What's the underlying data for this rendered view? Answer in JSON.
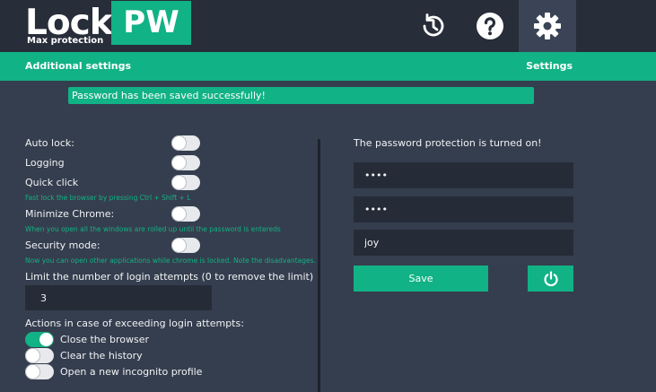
{
  "header": {
    "logo_main": "Lock",
    "logo_sub": "Max protection",
    "logo_badge": "PW",
    "icons": [
      "history-icon",
      "help-icon",
      "gear-icon"
    ]
  },
  "nav": {
    "additional_settings": "Additional settings",
    "settings": "Settings"
  },
  "banner": {
    "message": "Password has been saved successfully!"
  },
  "left": {
    "auto_lock": {
      "label": "Auto lock:",
      "on": false
    },
    "logging": {
      "label": "Logging",
      "on": false
    },
    "quick_click": {
      "label": "Quick click",
      "hint": "Fast lock the browser by pressing Ctrl + Shift + L",
      "on": false
    },
    "minimize_chrome": {
      "label": "Minimize Chrome:",
      "hint": "When you open all the windows are rolled up until the password is entereds",
      "on": false
    },
    "security_mode": {
      "label": "Security mode:",
      "hint": "Now you can open other applications while chrome is locked. Note the disadvantages.",
      "on": false
    },
    "limit_label": "Limit the number of login attempts (0 to remove the limit)",
    "limit_value": "3",
    "actions_label": "Actions in case of exceeding login attempts:",
    "actions": [
      {
        "label": "Close the browser",
        "on": true
      },
      {
        "label": "Clear the history",
        "on": false
      },
      {
        "label": "Open a new incognito profile",
        "on": false
      }
    ]
  },
  "right": {
    "status": "The password protection is turned on!",
    "password": "••••",
    "password_confirm": "••••",
    "hint_value": "joy",
    "save_label": "Save",
    "power_icon": "power-icon"
  },
  "colors": {
    "accent": "#11b285",
    "header_bg": "#272d39",
    "body_bg": "#353e4e",
    "input_bg": "#262c37"
  }
}
